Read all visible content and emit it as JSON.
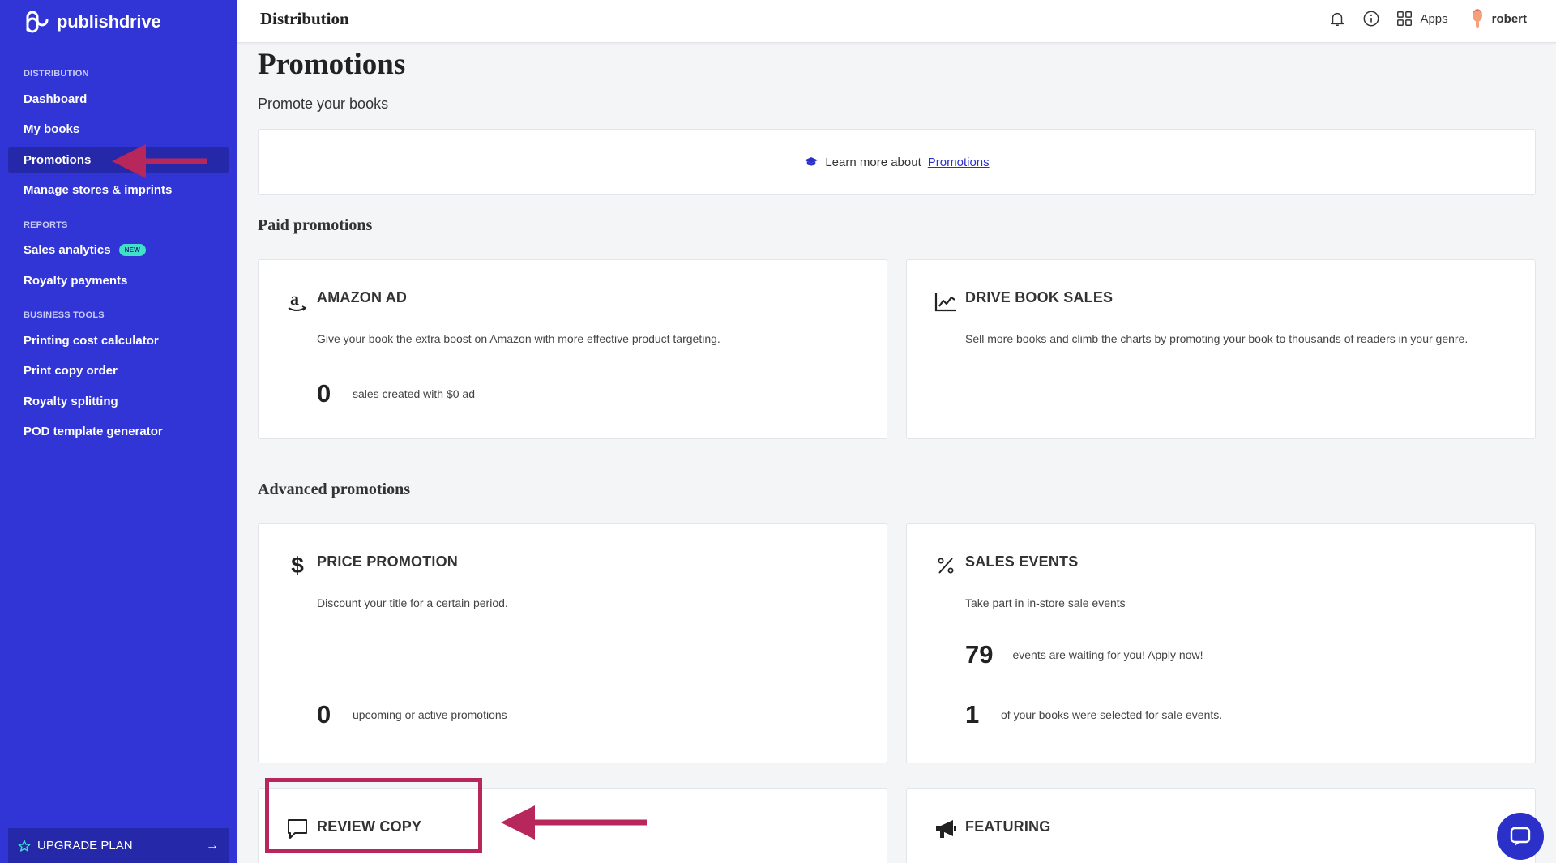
{
  "app": {
    "name": "publishdrive"
  },
  "sidebar": {
    "sections": [
      {
        "label": "DISTRIBUTION"
      },
      {
        "label": "REPORTS"
      },
      {
        "label": "BUSINESS TOOLS"
      }
    ],
    "items": [
      {
        "label": "Dashboard"
      },
      {
        "label": "My books"
      },
      {
        "label": "Promotions"
      },
      {
        "label": "Manage stores & imprints"
      },
      {
        "label": "Sales analytics",
        "badge": "NEW"
      },
      {
        "label": "Royalty payments"
      },
      {
        "label": "Printing cost calculator"
      },
      {
        "label": "Print copy order"
      },
      {
        "label": "Royalty splitting"
      },
      {
        "label": "POD template generator"
      }
    ],
    "upgrade_label": "UPGRADE PLAN"
  },
  "header": {
    "title": "Distribution",
    "apps_label": "Apps",
    "user_name": "robert"
  },
  "page": {
    "title": "Promotions",
    "subtitle": "Promote your books",
    "learn_prefix": "Learn more about",
    "learn_link": "Promotions"
  },
  "sections": {
    "paid": "Paid promotions",
    "advanced": "Advanced promotions"
  },
  "cards": {
    "amazon": {
      "title": "AMAZON AD",
      "desc": "Give your book the extra boost on Amazon with more effective product targeting.",
      "stat_value": "0",
      "stat_label": "sales created with $0 ad"
    },
    "drive": {
      "title": "DRIVE BOOK SALES",
      "desc": "Sell more books and climb the charts by promoting your book to thousands of readers in your genre."
    },
    "price": {
      "title": "PRICE PROMOTION",
      "desc": "Discount your title for a certain period.",
      "stat_value": "0",
      "stat_label": "upcoming or active promotions"
    },
    "sales_events": {
      "title": "SALES EVENTS",
      "desc": "Take part in in-store sale events",
      "stat1_value": "79",
      "stat1_label": "events are waiting for you! Apply now!",
      "stat2_value": "1",
      "stat2_label": "of your books were selected for sale events."
    },
    "review": {
      "title": "REVIEW COPY"
    },
    "featuring": {
      "title": "FEATURING"
    }
  },
  "colors": {
    "sidebar": "#3135d6",
    "sidebar_active": "#2528a8",
    "accent": "#2b30c9",
    "annotation": "#b8275b"
  }
}
